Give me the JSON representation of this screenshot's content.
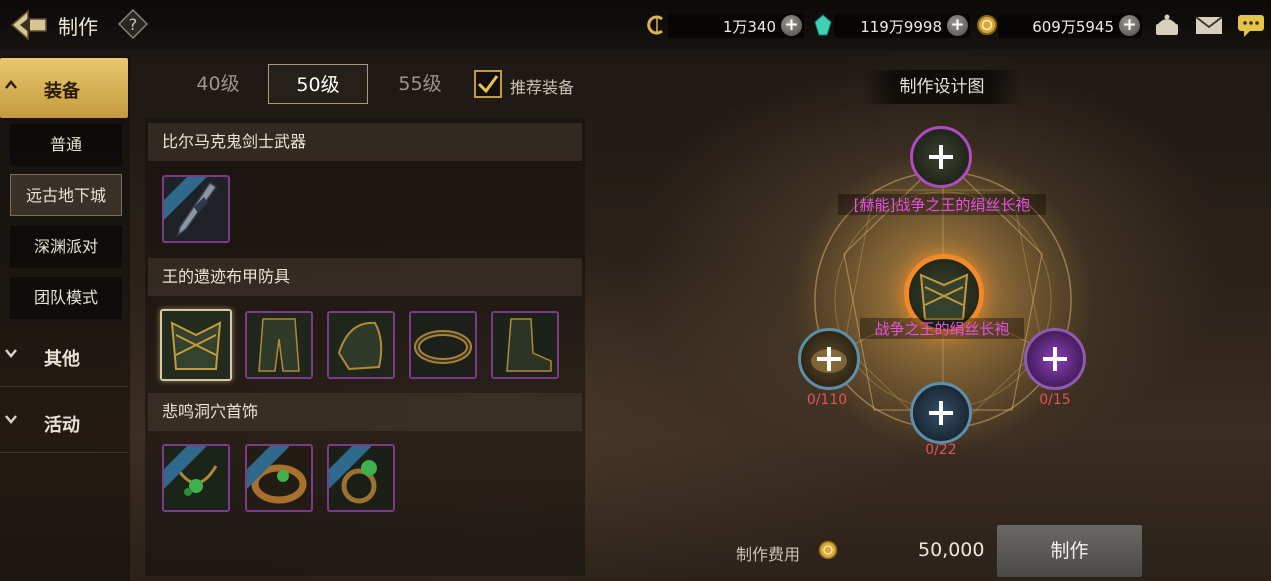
{
  "header": {
    "title": "制作",
    "currencies": [
      {
        "icon": "gold-c-coin-icon",
        "value": "1万340"
      },
      {
        "icon": "teal-crystal-icon",
        "value": "119万9998"
      },
      {
        "icon": "gold-coin-icon",
        "value": "609万5945"
      }
    ],
    "right_icons": [
      "merchant-icon",
      "mail-icon",
      "chat-icon"
    ]
  },
  "sidebar": {
    "items": [
      {
        "label": "装备",
        "expanded": true,
        "active": true
      },
      {
        "label": "其他",
        "expanded": false
      },
      {
        "label": "活动",
        "expanded": false
      }
    ],
    "sub_items": [
      {
        "label": "普通"
      },
      {
        "label": "远古地下城",
        "active": true
      },
      {
        "label": "深渊派对"
      },
      {
        "label": "团队模式"
      }
    ]
  },
  "level_tabs": [
    {
      "label": "40级"
    },
    {
      "label": "50级",
      "active": true
    },
    {
      "label": "55级"
    }
  ],
  "recommend": {
    "label": "推荐装备",
    "checked": true
  },
  "sections": [
    {
      "title": "比尔马克鬼剑士武器",
      "items": [
        "weapon-blade-icon"
      ]
    },
    {
      "title": "王的遗迹布甲防具",
      "items": [
        "robe-icon",
        "leggings-icon",
        "shoulder-icon",
        "belt-icon",
        "boots-icon"
      ]
    },
    {
      "title": "悲鸣洞穴首饰",
      "items": [
        "necklace-icon",
        "bracelet-icon",
        "ring-icon"
      ]
    }
  ],
  "design": {
    "title": "制作设计图",
    "upgrade_name": "[赫能]战争之王的绢丝长袍",
    "center_name": "战争之王的绢丝长袍",
    "materials": [
      {
        "count": "0/110"
      },
      {
        "count": "0/22"
      },
      {
        "count": "0/15"
      }
    ]
  },
  "cost": {
    "label": "制作费用",
    "value": "50,000",
    "button": "制作"
  },
  "colors": {
    "accent_gold": "#c59a3e",
    "epic_purple": "#7b3b86",
    "name_magenta": "#ec4fe9",
    "shortage_red": "#e0555a"
  }
}
